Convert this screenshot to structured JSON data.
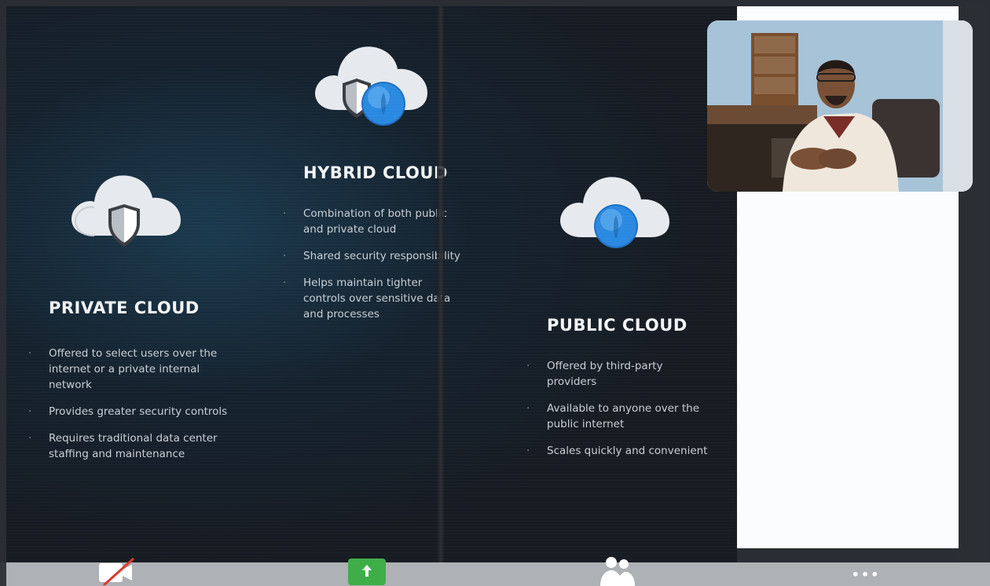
{
  "slide": {
    "private": {
      "title": "PRIVATE CLOUD",
      "bullets": [
        "Offered to select users over the internet or a private internal network",
        "Provides greater security controls",
        "Requires traditional data center staffing and maintenance"
      ]
    },
    "hybrid": {
      "title": "HYBRID CLOUD",
      "bullets": [
        "Combination of both public and private cloud",
        "Shared security responsibility",
        "Helps maintain tighter controls over sensitive data and processes"
      ]
    },
    "public": {
      "title": "PUBLIC CLOUD",
      "bullets": [
        "Offered by third-party providers",
        "Available to anyone over the public internet",
        "Scales quickly and convenient"
      ]
    }
  },
  "icons": {
    "private": "cloud-shield-icon",
    "hybrid": "cloud-shield-globe-icon",
    "public": "cloud-globe-icon",
    "camera": "camera-off-icon",
    "share": "share-screen-icon",
    "participants": "participants-icon",
    "more": "more-icon"
  },
  "colors": {
    "slide_bg": "#171b22",
    "heading": "#f2f4f6",
    "bullet_text": "#c9cfd5",
    "share_button": "#3fae49",
    "camera_off_slash": "#d93a2b",
    "toolbar_bg": "#aeb1b5"
  },
  "toolbar": {
    "more_label": "•••"
  }
}
